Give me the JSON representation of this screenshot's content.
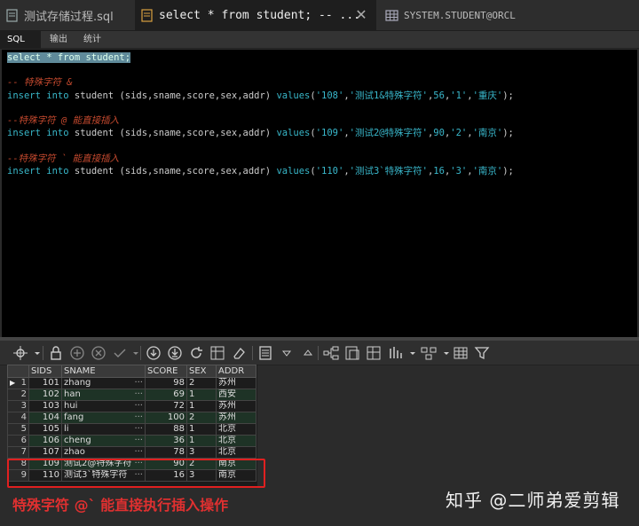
{
  "tabs": [
    {
      "label": "测试存储过程.sql",
      "active": false
    },
    {
      "label": "select * from student; --   ...",
      "active": true
    },
    {
      "label": "SYSTEM.STUDENT@ORCL",
      "active": false
    }
  ],
  "subtabs": [
    "SQL",
    "输出",
    "统计"
  ],
  "editor": {
    "lines": [
      {
        "parts": [
          {
            "t": "select * from student;",
            "c": "sel"
          }
        ]
      },
      {
        "parts": []
      },
      {
        "parts": [
          {
            "t": "-- 特殊字符 &",
            "c": "cmt"
          }
        ]
      },
      {
        "parts": [
          {
            "t": "insert into",
            "c": "kw"
          },
          {
            "t": " student (sids,sname,score,sex,addr) ",
            "c": "plain"
          },
          {
            "t": "values",
            "c": "kw"
          },
          {
            "t": "(",
            "c": "plain"
          },
          {
            "t": "'108'",
            "c": "str"
          },
          {
            "t": ",",
            "c": "plain"
          },
          {
            "t": "'测试1&特殊字符'",
            "c": "str"
          },
          {
            "t": ",",
            "c": "plain"
          },
          {
            "t": "56",
            "c": "str"
          },
          {
            "t": ",",
            "c": "plain"
          },
          {
            "t": "'1'",
            "c": "str"
          },
          {
            "t": ",",
            "c": "plain"
          },
          {
            "t": "'重庆'",
            "c": "str"
          },
          {
            "t": ");",
            "c": "plain"
          }
        ]
      },
      {
        "parts": []
      },
      {
        "parts": [
          {
            "t": "--特殊字符 @ 能直接插入",
            "c": "cmt"
          }
        ]
      },
      {
        "parts": [
          {
            "t": "insert into",
            "c": "kw"
          },
          {
            "t": " student (sids,sname,score,sex,addr) ",
            "c": "plain"
          },
          {
            "t": "values",
            "c": "kw"
          },
          {
            "t": "(",
            "c": "plain"
          },
          {
            "t": "'109'",
            "c": "str"
          },
          {
            "t": ",",
            "c": "plain"
          },
          {
            "t": "'测试2@特殊字符'",
            "c": "str"
          },
          {
            "t": ",",
            "c": "plain"
          },
          {
            "t": "90",
            "c": "str"
          },
          {
            "t": ",",
            "c": "plain"
          },
          {
            "t": "'2'",
            "c": "str"
          },
          {
            "t": ",",
            "c": "plain"
          },
          {
            "t": "'南京'",
            "c": "str"
          },
          {
            "t": ");",
            "c": "plain"
          }
        ]
      },
      {
        "parts": []
      },
      {
        "parts": [
          {
            "t": "--特殊字符 ` 能直接插入",
            "c": "cmt"
          }
        ]
      },
      {
        "parts": [
          {
            "t": "insert into",
            "c": "kw"
          },
          {
            "t": " student (sids,sname,score,sex,addr) ",
            "c": "plain"
          },
          {
            "t": "values",
            "c": "kw"
          },
          {
            "t": "(",
            "c": "plain"
          },
          {
            "t": "'110'",
            "c": "str"
          },
          {
            "t": ",",
            "c": "plain"
          },
          {
            "t": "'测试3`特殊字符'",
            "c": "str"
          },
          {
            "t": ",",
            "c": "plain"
          },
          {
            "t": "16",
            "c": "str"
          },
          {
            "t": ",",
            "c": "plain"
          },
          {
            "t": "'3'",
            "c": "str"
          },
          {
            "t": ",",
            "c": "plain"
          },
          {
            "t": "'南京'",
            "c": "str"
          },
          {
            "t": ");",
            "c": "plain"
          }
        ]
      }
    ]
  },
  "grid": {
    "columns": [
      "SIDS",
      "SNAME",
      "SCORE",
      "SEX",
      "ADDR"
    ],
    "rows": [
      {
        "n": "1",
        "sids": "101",
        "sname": "zhang",
        "score": "98",
        "sex": "2",
        "addr": "苏州"
      },
      {
        "n": "2",
        "sids": "102",
        "sname": "han",
        "score": "69",
        "sex": "1",
        "addr": "西安"
      },
      {
        "n": "3",
        "sids": "103",
        "sname": "hui",
        "score": "72",
        "sex": "1",
        "addr": "苏州"
      },
      {
        "n": "4",
        "sids": "104",
        "sname": "fang",
        "score": "100",
        "sex": "2",
        "addr": "苏州"
      },
      {
        "n": "5",
        "sids": "105",
        "sname": "li",
        "score": "88",
        "sex": "1",
        "addr": "北京"
      },
      {
        "n": "6",
        "sids": "106",
        "sname": "cheng",
        "score": "36",
        "sex": "1",
        "addr": "北京"
      },
      {
        "n": "7",
        "sids": "107",
        "sname": "zhao",
        "score": "78",
        "sex": "3",
        "addr": "北京"
      },
      {
        "n": "8",
        "sids": "109",
        "sname": "测试2@特殊字符",
        "score": "90",
        "sex": "2",
        "addr": "南京"
      },
      {
        "n": "9",
        "sids": "110",
        "sname": "测试3`特殊字符",
        "score": "16",
        "sex": "3",
        "addr": "南京"
      }
    ],
    "cell_ellipsis": "···"
  },
  "annotation": {
    "caption": "特殊字符 @` 能直接执行插入操作",
    "watermark": "知乎 @二师弟爱剪辑"
  },
  "colors": {
    "keyword": "#38b7c9",
    "comment": "#c4492e",
    "highlight_box": "#e02020",
    "even_row": "#1e3326"
  }
}
